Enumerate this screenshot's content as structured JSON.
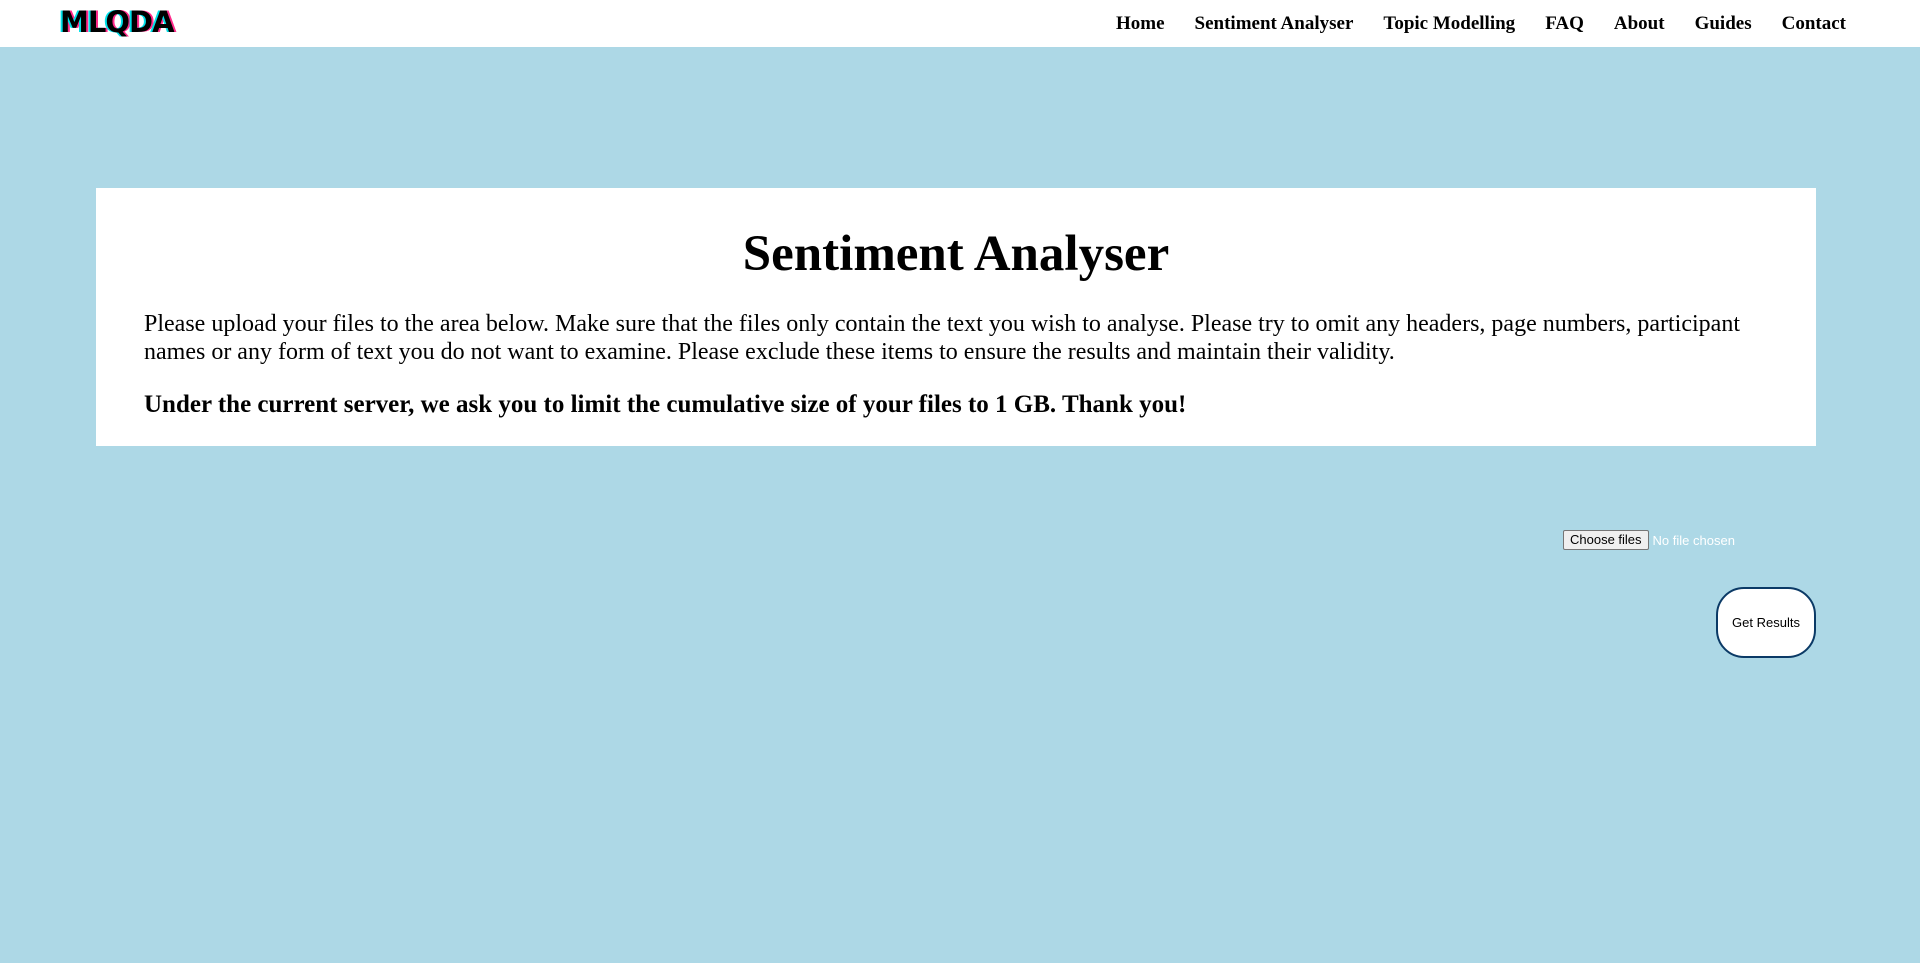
{
  "navbar": {
    "logo": "MLQDA",
    "links": [
      "Home",
      "Sentiment Analyser",
      "Topic Modelling",
      "FAQ",
      "About",
      "Guides",
      "Contact"
    ]
  },
  "main": {
    "title": "Sentiment Analyser",
    "instructions": "Please upload your files to the area below. Make sure that the files only contain the text you wish to analyse. Please try to omit any headers, page numbers, participant names or any form of text you do not want to examine. Please exclude these items to ensure the results and maintain their validity.",
    "size_note": "Under the current server, we ask you to limit the cumulative size of your files to 1 GB. Thank you!"
  },
  "upload": {
    "choose_label": "Choose files",
    "status": "No file chosen",
    "submit_label": "Get Results"
  },
  "colors": {
    "background": "#add8e6",
    "card": "#ffffff",
    "button_border": "#0b3a66"
  }
}
